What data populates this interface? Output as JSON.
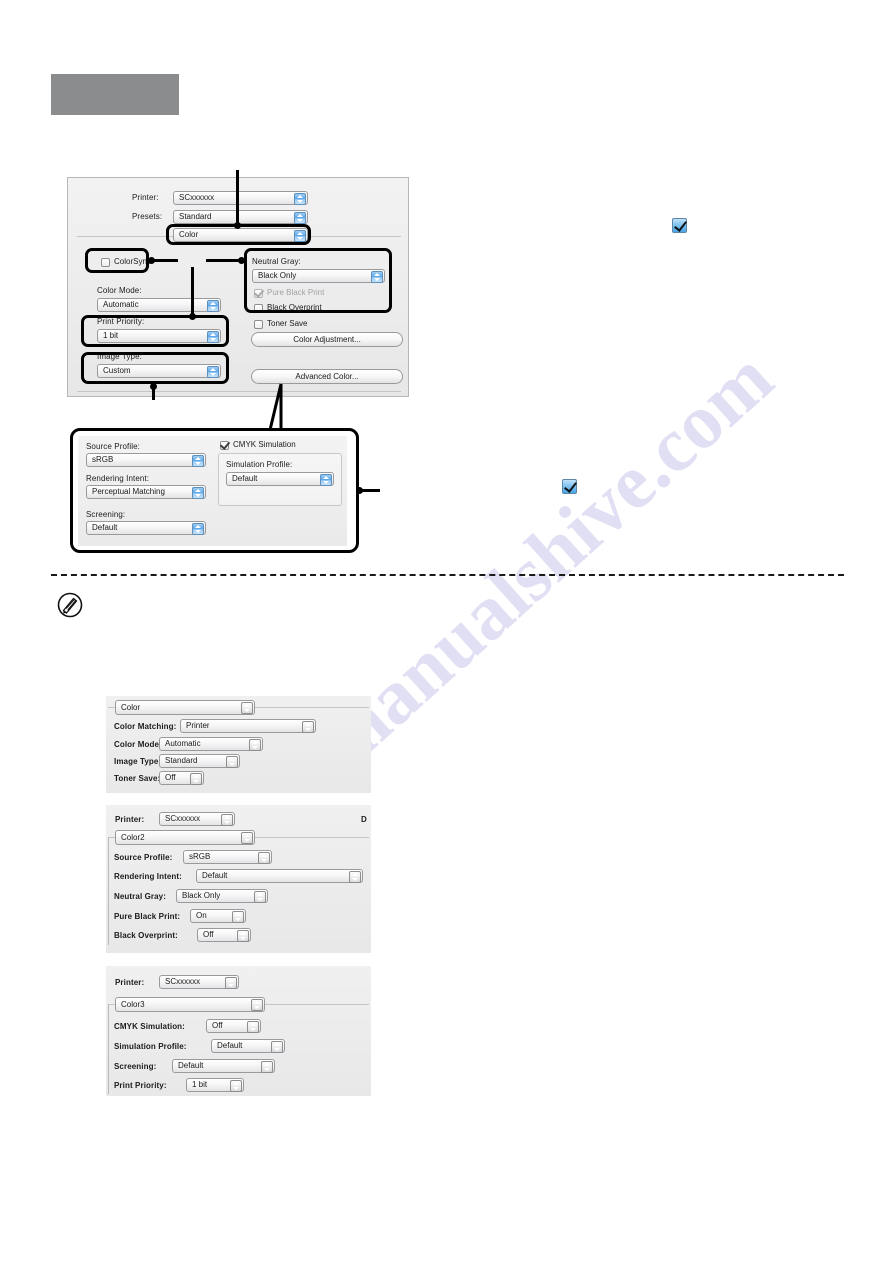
{
  "watermark": {
    "text": "manualshive.com"
  },
  "icons": {
    "note": "pencil-circle-icon",
    "blue_check": "blue-checkmark-icon"
  },
  "main_dialog": {
    "name": "print-color-dialog",
    "rows": {
      "printer_label": "Printer:",
      "printer_value": "SCxxxxxx",
      "presets_label": "Presets:",
      "presets_value": "Standard",
      "pane_value": "Color"
    },
    "left": {
      "colorsync_label": "ColorSync",
      "color_mode_label": "Color Mode:",
      "color_mode_value": "Automatic",
      "print_priority_label": "Print Priority:",
      "print_priority_value": "1 bit",
      "image_type_label": "Image Type:",
      "image_type_value": "Custom"
    },
    "right": {
      "neutral_gray_label": "Neutral Gray:",
      "neutral_gray_value": "Black Only",
      "pure_black_print_label": "Pure Black Print",
      "black_overprint_label": "Black Overprint",
      "toner_save_label": "Toner Save",
      "color_adjustment_button": "Color Adjustment...",
      "advanced_color_button": "Advanced Color..."
    }
  },
  "advanced_dialog": {
    "name": "advanced-color-dialog",
    "source_profile_label": "Source Profile:",
    "source_profile_value": "sRGB",
    "rendering_intent_label": "Rendering Intent:",
    "rendering_intent_value": "Perceptual Matching",
    "screening_label": "Screening:",
    "screening_value": "Default",
    "cmyk_simulation_label": "CMYK Simulation",
    "simulation_profile_label": "Simulation Profile:",
    "simulation_profile_value": "Default"
  },
  "panel_color": {
    "name": "color-panel",
    "pane_value": "Color",
    "rows": [
      {
        "label": "Color Matching:",
        "value": "Printer"
      },
      {
        "label": "Color Mode:",
        "value": "Automatic"
      },
      {
        "label": "Image Type:",
        "value": "Standard"
      },
      {
        "label": "Toner Save:",
        "value": "Off"
      }
    ]
  },
  "panel_color2": {
    "name": "color2-panel",
    "printer_label": "Printer:",
    "printer_value": "SCxxxxxx",
    "trailing_text": "D",
    "pane_value": "Color2",
    "rows": [
      {
        "label": "Source Profile:",
        "value": "sRGB"
      },
      {
        "label": "Rendering Intent:",
        "value": "Default"
      },
      {
        "label": "Neutral Gray:",
        "value": "Black Only"
      },
      {
        "label": "Pure Black Print:",
        "value": "On"
      },
      {
        "label": "Black Overprint:",
        "value": "Off"
      }
    ]
  },
  "panel_color3": {
    "name": "color3-panel",
    "printer_label": "Printer:",
    "printer_value": "SCxxxxxx",
    "pane_value": "Color3",
    "rows": [
      {
        "label": "CMYK Simulation:",
        "value": "Off"
      },
      {
        "label": "Simulation Profile:",
        "value": "Default"
      },
      {
        "label": "Screening:",
        "value": "Default"
      },
      {
        "label": "Print Priority:",
        "value": "1 bit"
      }
    ]
  }
}
